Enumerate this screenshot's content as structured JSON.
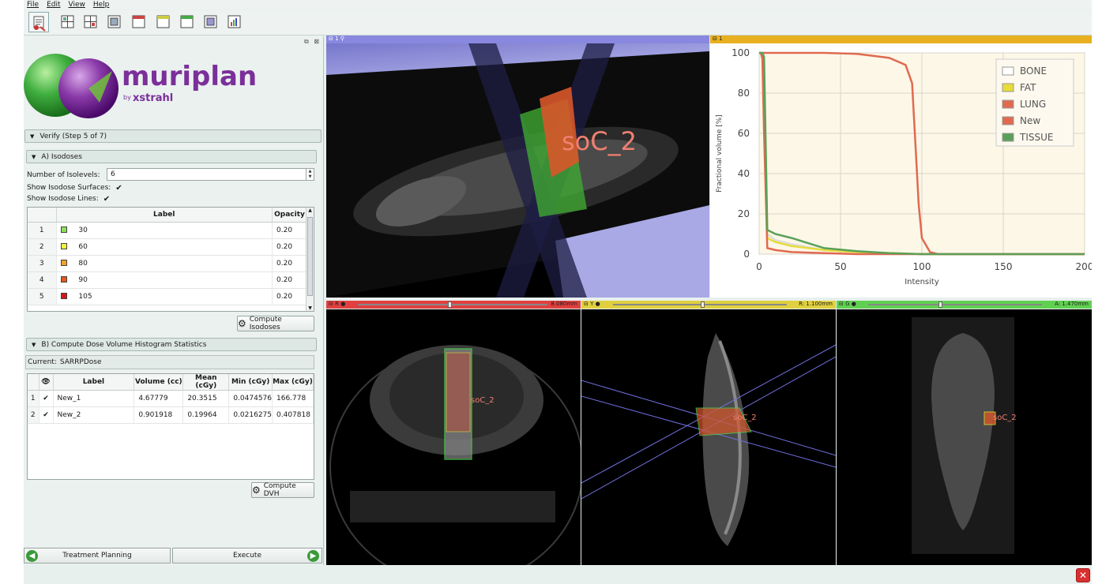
{
  "menu": [
    "File",
    "Edit",
    "View",
    "Help"
  ],
  "toolbar_icons": [
    "module-icon",
    "layout-conventional-icon",
    "layout-fourup-icon",
    "layout-onedup-icon",
    "layout-red-icon",
    "layout-yellow-icon",
    "layout-green-icon",
    "layout-3d-icon",
    "chart-icon"
  ],
  "logo": {
    "name": "muriplan",
    "by": "by",
    "brand": "xstrahl"
  },
  "verify": {
    "title": "Verify (Step 5 of 7)"
  },
  "isodoses": {
    "title": "A) Isodoses",
    "num_label": "Number of Isolevels:",
    "num_value": "6",
    "show_surfaces_label": "Show Isodose Surfaces:",
    "show_lines_label": "Show Isodose Lines:",
    "col_label": "Label",
    "col_opacity": "Opacity",
    "rows": [
      {
        "idx": "1",
        "label": "30",
        "opacity": "0.20",
        "color": "#8ee05a"
      },
      {
        "idx": "2",
        "label": "60",
        "opacity": "0.20",
        "color": "#f2f23a"
      },
      {
        "idx": "3",
        "label": "80",
        "opacity": "0.20",
        "color": "#f2a22a"
      },
      {
        "idx": "4",
        "label": "90",
        "opacity": "0.20",
        "color": "#e5561e"
      },
      {
        "idx": "5",
        "label": "105",
        "opacity": "0.20",
        "color": "#d01818"
      }
    ],
    "compute_button": "Compute Isodoses"
  },
  "dvh": {
    "title": "B) Compute Dose Volume Histogram Statistics",
    "current_label": "Current:",
    "current_value": "SARRPDose",
    "columns": [
      "Label",
      "Volume (cc)",
      "Mean (cGy)",
      "Min (cGy)",
      "Max (cGy)"
    ],
    "rows": [
      {
        "idx": "1",
        "label": "New_1",
        "volume": "4.67779",
        "mean": "20.3515",
        "min": "0.0474576",
        "max": "166.778"
      },
      {
        "idx": "2",
        "label": "New_2",
        "volume": "0.901918",
        "mean": "0.19964",
        "min": "0.0216275",
        "max": "0.407818"
      }
    ],
    "compute_button": "Compute DVH"
  },
  "nav": {
    "back": "Treatment Planning",
    "next": "Execute"
  },
  "views": {
    "threeD": {
      "id": "1",
      "overlay": "soC_2"
    },
    "chart": {
      "id": "1"
    },
    "red": {
      "letter": "R",
      "value": "8.080mm",
      "overlay": "soC_2",
      "slider_pos": 0.47
    },
    "yellow": {
      "letter": "Y",
      "value": "R: 1.100mm",
      "overlay": "soC_2",
      "slider_pos": 0.5
    },
    "green": {
      "letter": "G",
      "value": "A: 1.470mm",
      "overlay": "soC_2",
      "slider_pos": 0.4
    }
  },
  "chart_data": {
    "type": "line",
    "xlabel": "Intensity",
    "ylabel": "Fractional volume [%]",
    "xlim": [
      0,
      200
    ],
    "ylim": [
      0,
      100
    ],
    "xticks": [
      0,
      50,
      100,
      150,
      200
    ],
    "yticks": [
      0,
      20,
      40,
      60,
      80,
      100
    ],
    "legend_position": "top-right",
    "series": [
      {
        "name": "BONE",
        "color": "#ffffff",
        "x": [
          0,
          1,
          2,
          3,
          5,
          10,
          20,
          40,
          60,
          100,
          200
        ],
        "y": [
          100,
          100,
          99,
          95,
          10,
          7,
          5,
          2,
          1,
          0,
          0
        ]
      },
      {
        "name": "FAT",
        "color": "#e6dc3a",
        "x": [
          0,
          1,
          2,
          3,
          5,
          10,
          20,
          40,
          60,
          100,
          200
        ],
        "y": [
          100,
          100,
          98,
          90,
          8,
          6,
          4,
          2,
          1,
          0,
          0
        ]
      },
      {
        "name": "LUNG",
        "color": "#e06a50",
        "x": [
          0,
          1,
          2,
          3,
          5,
          10,
          20,
          40,
          60,
          100,
          200
        ],
        "y": [
          100,
          100,
          97,
          60,
          3,
          2,
          1,
          0.5,
          0,
          0,
          0
        ]
      },
      {
        "name": "New",
        "color": "#e06a50",
        "x": [
          0,
          5,
          20,
          40,
          60,
          70,
          80,
          90,
          94,
          96,
          98,
          100,
          105,
          110,
          200
        ],
        "y": [
          100,
          100,
          100,
          100,
          99.5,
          98.5,
          97.5,
          94,
          85,
          55,
          25,
          8,
          1,
          0,
          0
        ]
      },
      {
        "name": "TISSUE",
        "color": "#5aa05a",
        "x": [
          0,
          1,
          2,
          3,
          5,
          10,
          20,
          40,
          60,
          80,
          100,
          200
        ],
        "y": [
          100,
          100,
          100,
          98,
          12,
          10,
          8,
          3,
          1.5,
          0.5,
          0,
          0
        ]
      }
    ]
  }
}
